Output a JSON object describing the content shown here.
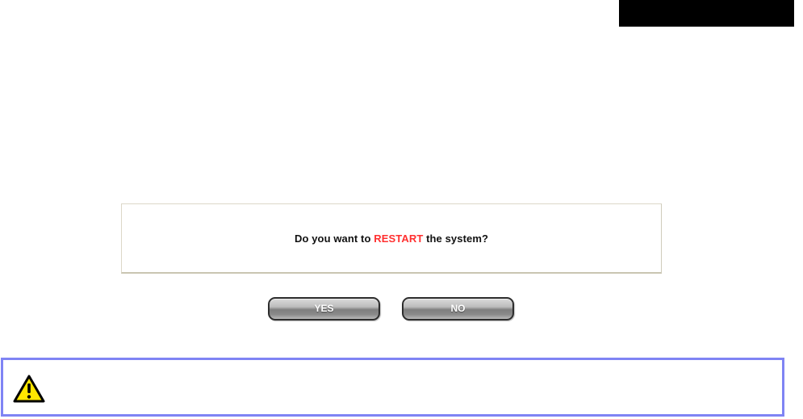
{
  "dialog": {
    "question_prefix": "Do you want to",
    "question_highlight": "RESTART",
    "question_suffix": "the system?"
  },
  "buttons": {
    "yes_label": "YES",
    "no_label": "NO"
  },
  "warning": {
    "icon": "warning-triangle-icon"
  },
  "colors": {
    "highlight": "#ff3030",
    "warning_border": "#7f84f4",
    "warning_icon_fill": "#ffe600"
  }
}
